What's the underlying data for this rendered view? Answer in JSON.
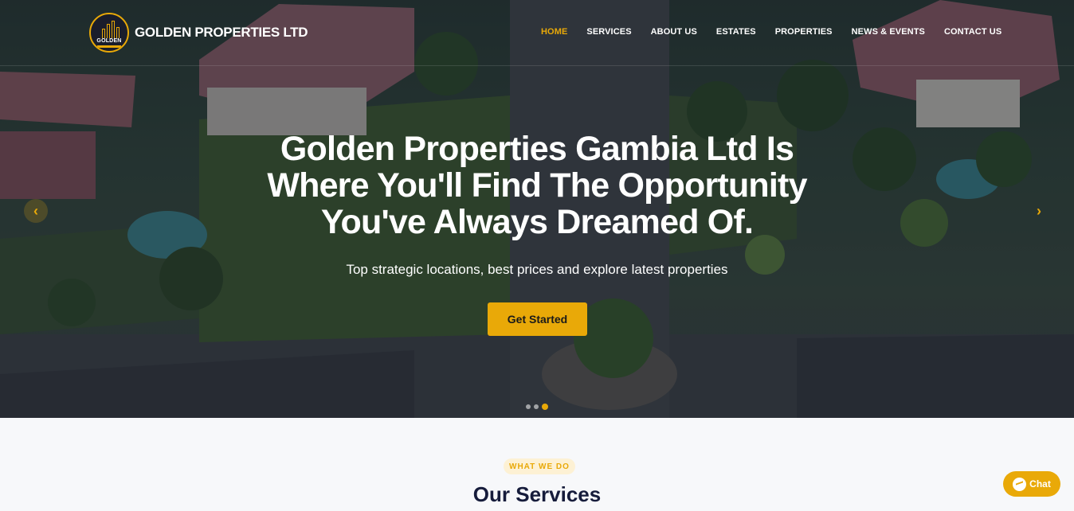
{
  "brand": {
    "name": "GOLDEN PROPERTIES LTD",
    "badge_text": "GOLDEN",
    "accent": "#e9a908"
  },
  "nav": {
    "items": [
      {
        "label": "HOME",
        "active": true
      },
      {
        "label": "SERVICES"
      },
      {
        "label": "ABOUT US"
      },
      {
        "label": "ESTATES"
      },
      {
        "label": "PROPERTIES"
      },
      {
        "label": "NEWS & EVENTS"
      },
      {
        "label": "CONTACT US"
      }
    ]
  },
  "hero": {
    "headline": "Golden Properties Gambia Ltd Is Where You'll Find The Opportunity You've Always Dreamed Of.",
    "subtitle": "Top strategic locations, best prices and explore latest properties",
    "cta_label": "Get Started",
    "prev_icon": "chevron-left-icon",
    "next_icon": "chevron-right-icon",
    "slides_total": 3,
    "active_slide": 3
  },
  "services": {
    "tag": "WHAT WE DO",
    "title": "Our Services"
  },
  "chat": {
    "label": "Chat",
    "icon": "messenger-icon"
  }
}
